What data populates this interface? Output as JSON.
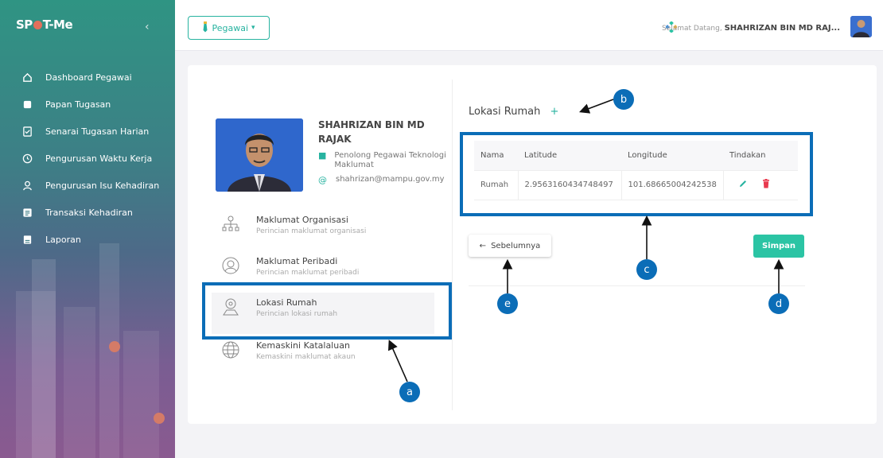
{
  "sidebar": {
    "brand": {
      "pre": "SP",
      "post": "T-Me"
    },
    "collapse_icon": "chevron-left-icon",
    "items": [
      {
        "label": "Dashboard Pegawai",
        "icon": "home-icon"
      },
      {
        "label": "Papan Tugasan",
        "icon": "board-icon"
      },
      {
        "label": "Senarai Tugasan Harian",
        "icon": "checklist-icon"
      },
      {
        "label": "Pengurusan Waktu Kerja",
        "icon": "clock-icon"
      },
      {
        "label": "Pengurusan Isu Kehadiran",
        "icon": "user-icon"
      },
      {
        "label": "Transaksi Kehadiran",
        "icon": "list-icon"
      },
      {
        "label": "Laporan",
        "icon": "report-icon"
      }
    ]
  },
  "topbar": {
    "role_label": "Pegawai",
    "welcome_label": "Selamat Datang,",
    "user_name": "SHAHRIZAN BIN MD RAJ..."
  },
  "profile": {
    "name": "SHAHRIZAN BIN MD RAJAK",
    "position": "Penolong Pegawai Teknologi Maklumat",
    "email": "shahrizan@mampu.gov.my"
  },
  "menu": [
    {
      "title": "Maklumat Organisasi",
      "subtitle": "Perincian maklumat organisasi",
      "icon": "org-chart-icon"
    },
    {
      "title": "Maklumat Peribadi",
      "subtitle": "Perincian maklumat peribadi",
      "icon": "person-icon"
    },
    {
      "title": "Lokasi Rumah",
      "subtitle": "Perincian lokasi rumah",
      "icon": "home-location-icon"
    },
    {
      "title": "Kemaskini Katalaluan",
      "subtitle": "Kemaskini maklumat akaun",
      "icon": "globe-icon"
    }
  ],
  "section": {
    "title": "Lokasi Rumah",
    "add_symbol": "+"
  },
  "table": {
    "headers": [
      "Nama",
      "Latitude",
      "Longitude",
      "Tindakan"
    ],
    "rows": [
      {
        "nama": "Rumah",
        "latitude": "2.9563160434748497",
        "longitude": "101.68665004242538"
      }
    ]
  },
  "buttons": {
    "prev": "Sebelumnya",
    "save": "Simpan"
  },
  "callouts": {
    "a": "a",
    "b": "b",
    "c": "c",
    "d": "d",
    "e": "e"
  },
  "colors": {
    "accent": "#27b3a0",
    "callout": "#0b6db7",
    "delete": "#e8394e",
    "save": "#2bc4a4"
  }
}
